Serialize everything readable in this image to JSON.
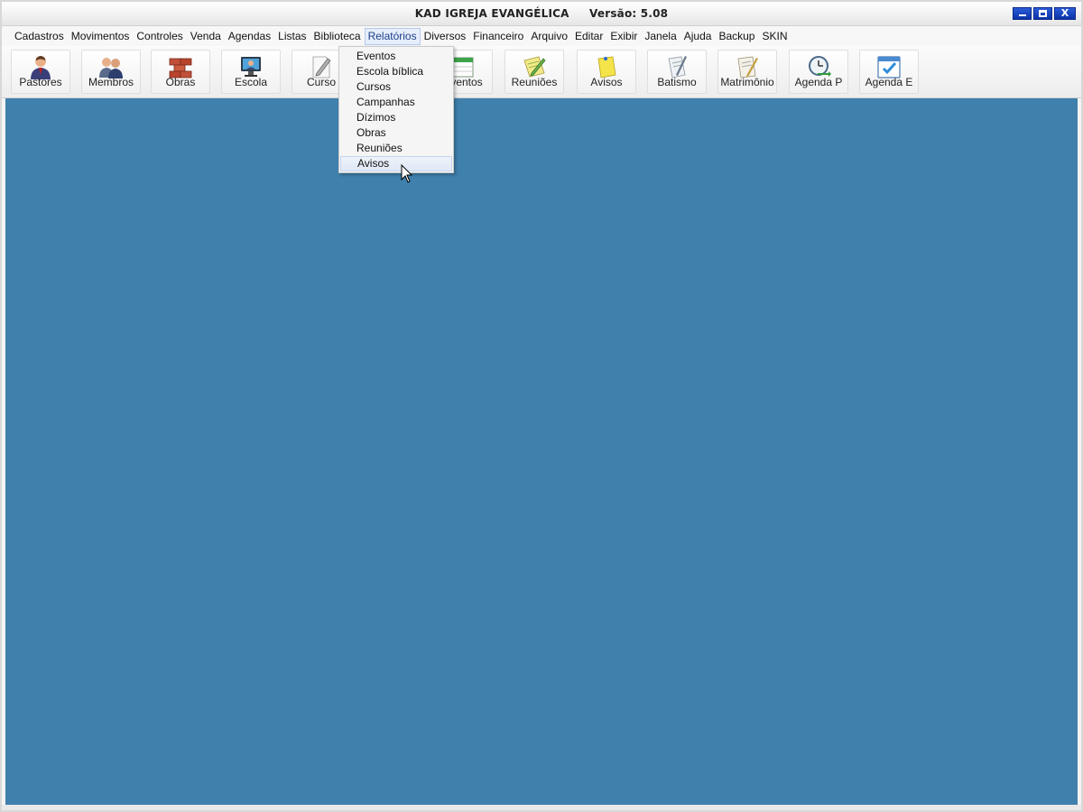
{
  "window": {
    "title": "KAD IGREJA EVANGÉLICA",
    "version": "Versão: 5.08",
    "controls": {
      "close_label": "X"
    }
  },
  "menubar": {
    "items": [
      {
        "id": "cadastros",
        "label": "Cadastros"
      },
      {
        "id": "movimentos",
        "label": "Movimentos"
      },
      {
        "id": "controles",
        "label": "Controles"
      },
      {
        "id": "venda",
        "label": "Venda"
      },
      {
        "id": "agendas",
        "label": "Agendas"
      },
      {
        "id": "listas",
        "label": "Listas"
      },
      {
        "id": "biblioteca",
        "label": "Biblioteca"
      },
      {
        "id": "relatorios",
        "label": "Relatórios",
        "active": true
      },
      {
        "id": "diversos",
        "label": "Diversos"
      },
      {
        "id": "financeiro",
        "label": "Financeiro"
      },
      {
        "id": "arquivo",
        "label": "Arquivo"
      },
      {
        "id": "editar",
        "label": "Editar"
      },
      {
        "id": "exibir",
        "label": "Exibir"
      },
      {
        "id": "janela",
        "label": "Janela"
      },
      {
        "id": "ajuda",
        "label": "Ajuda"
      },
      {
        "id": "backup",
        "label": "Backup"
      },
      {
        "id": "skin",
        "label": "SKIN"
      }
    ]
  },
  "toolbar": {
    "buttons": [
      {
        "id": "pastores",
        "label": "Pastores",
        "icon": "pastor-icon"
      },
      {
        "id": "membros",
        "label": "Membros",
        "icon": "members-icon"
      },
      {
        "id": "obras",
        "label": "Obras",
        "icon": "bricks-icon"
      },
      {
        "id": "escola",
        "label": "Escola",
        "icon": "school-monitor-icon"
      },
      {
        "id": "curso",
        "label": "Curso",
        "icon": "pencil-paper-icon"
      },
      {
        "id": "eventos",
        "label": "Eventos",
        "icon": "calendar-icon"
      },
      {
        "id": "reunioes",
        "label": "Reuniões",
        "icon": "notepad-pencil-icon"
      },
      {
        "id": "avisos",
        "label": "Avisos",
        "icon": "sticky-note-icon"
      },
      {
        "id": "batismo",
        "label": "Batismo",
        "icon": "document-pen-icon"
      },
      {
        "id": "matrimonio",
        "label": "Matrimônio",
        "icon": "certificate-icon"
      },
      {
        "id": "agenda_p",
        "label": "Agenda P",
        "icon": "clock-arrow-icon"
      },
      {
        "id": "agenda_e",
        "label": "Agenda E",
        "icon": "calendar-check-icon"
      }
    ]
  },
  "dropdown": {
    "menu": "Relatórios",
    "items": [
      {
        "id": "eventos",
        "label": "Eventos"
      },
      {
        "id": "escola_biblica",
        "label": "Escola bíblica"
      },
      {
        "id": "cursos",
        "label": "Cursos"
      },
      {
        "id": "campanhas",
        "label": "Campanhas"
      },
      {
        "id": "dizimos",
        "label": "Dízimos"
      },
      {
        "id": "obras",
        "label": "Obras"
      },
      {
        "id": "reunioes",
        "label": "Reuniões"
      },
      {
        "id": "avisos",
        "label": "Avisos",
        "hover": true
      }
    ]
  },
  "colors": {
    "workspace": "#3f80ac",
    "titlebar_buttons": "#0b33a8",
    "menu_highlight": "#e6eefc"
  }
}
